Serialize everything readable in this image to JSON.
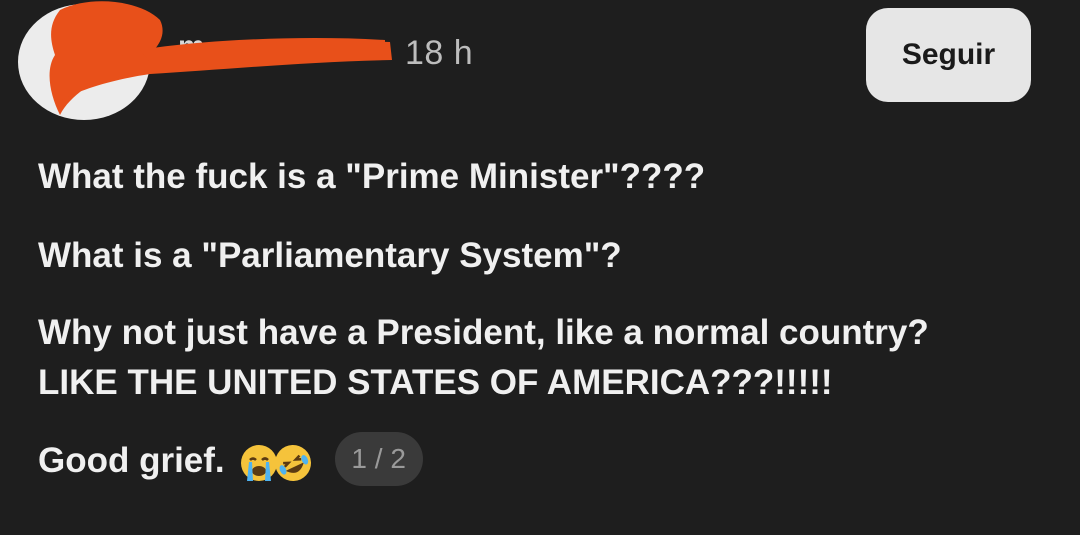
{
  "post": {
    "username": "m",
    "time_ago": "18 h",
    "follow_label": "Seguir",
    "lines": [
      "What the fuck is a \"Prime Minister\"????",
      "What is a \"Parliamentary System\"?",
      "Why not just have a President, like a normal country?",
      "LIKE THE UNITED STATES OF AMERICA???!!!!!",
      "Good grief."
    ],
    "emojis": [
      "crying-face-icon",
      "rofl-face-icon"
    ],
    "page_counter": "1 / 2"
  },
  "colors": {
    "background": "#1e1e1e",
    "text": "#f0f0f0",
    "button_bg": "#e6e6e6",
    "redaction": "#e8501a"
  }
}
